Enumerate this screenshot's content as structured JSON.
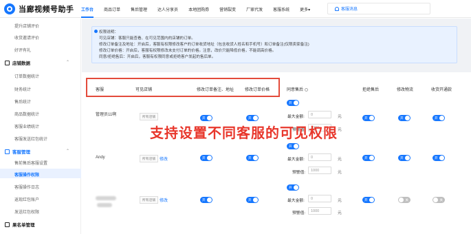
{
  "app": {
    "title": "当廊视频号助手"
  },
  "nav": [
    {
      "label": "工作台",
      "active": true
    },
    {
      "label": "商品订单"
    },
    {
      "label": "售后管理"
    },
    {
      "label": "达人分享员"
    },
    {
      "label": "本地团购券"
    },
    {
      "label": "营销裂变"
    },
    {
      "label": "厂家代发"
    },
    {
      "label": "客服系统"
    },
    {
      "label": "更多▾"
    }
  ],
  "notice": {
    "label": "客服消息"
  },
  "sidebar": {
    "items_top": [
      "提升店铺评价",
      "收货邀请评价",
      "好评有礼"
    ],
    "group_shop": "店铺数据",
    "shop_items": [
      "订单数据统计",
      "财务统计",
      "售后统计",
      "商品数据统计",
      "客服业绩统计",
      "客服发送红包统计"
    ],
    "group_service": "客服管理",
    "service_items": [
      "售前售后客服设置",
      "客服操作权限",
      "客服操作日志",
      "返现红包账户",
      "发送红包权限"
    ],
    "active_item": "客服操作权限",
    "group_bottom": "果名单管理"
  },
  "info": {
    "title": "权限说明：",
    "lines": [
      "可见店铺：客服只能查看、在可见范围内的店铺的订单。",
      "修改订单备注及地址：开启后，客服有权限修改客户的订单收货地址（包含收货人姓名和手机号）和订单备注(仅限卖家备注)",
      "修改订单价格：开启后，客服有权限修改未支付订单的价格。注意，改价只能降低价格，不能调高价格。",
      "同意/拒绝售后：开启后，客服有权限同意或拒绝客户发起的售后单。"
    ]
  },
  "table": {
    "headers": [
      "客服",
      "可见店铺",
      "修改订单备注、地址",
      "修改订单价格",
      "同意售后",
      "拒绝售后",
      "修改物流",
      "收货开通款"
    ],
    "rows": [
      {
        "name": "管理员11啊",
        "shop_tag": "所有店铺",
        "edit": "",
        "max_label": "最大金额:",
        "max_val": "0",
        "unit": "元",
        "warn_label": "预警值:",
        "warn_val": "1000"
      },
      {
        "name": "Andy",
        "shop_tag": "所有店铺",
        "edit": "修改",
        "max_label": "最大金额:",
        "max_val": "0",
        "unit": "元",
        "warn_label": "预警值:",
        "warn_val": "1000"
      },
      {
        "name": "",
        "shop_tag": "所有店铺",
        "edit": "修改",
        "max_label": "最大金额:",
        "max_val": "0",
        "unit": "元",
        "warn_label": "预警值:",
        "warn_val": "1000"
      }
    ],
    "toggle_on": "开",
    "toggle_off": "关"
  },
  "overlay": {
    "text": "支持设置不同客服的可见权限"
  },
  "colors": {
    "accent": "#1677ff",
    "highlight": "#e34a3a"
  }
}
